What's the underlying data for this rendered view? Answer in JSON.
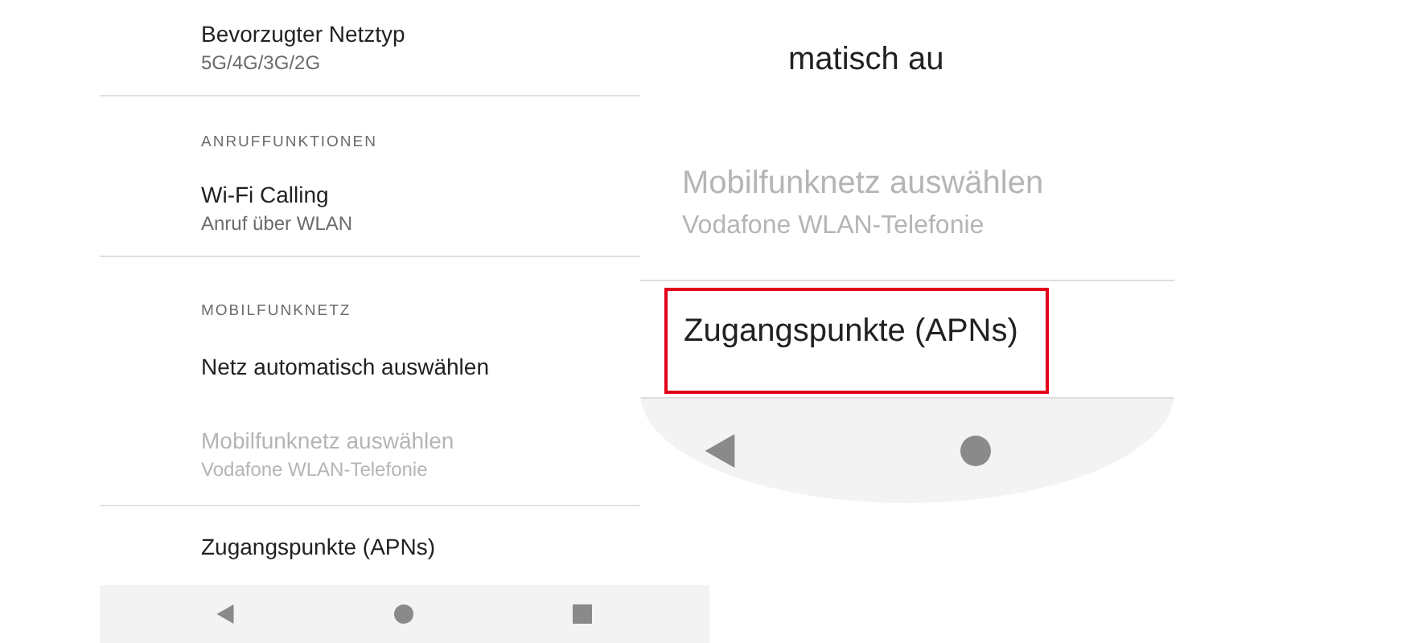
{
  "settings": {
    "items": [
      {
        "kind": "item",
        "title": "Bevorzugter Netztyp",
        "subtitle": "5G/4G/3G/2G",
        "disabled": false
      },
      {
        "kind": "header",
        "title": "ANRUFFUNKTIONEN"
      },
      {
        "kind": "item",
        "title": "Wi-Fi Calling",
        "subtitle": "Anruf über WLAN",
        "disabled": false
      },
      {
        "kind": "header",
        "title": "MOBILFUNKNETZ"
      },
      {
        "kind": "item",
        "title": "Netz automatisch auswählen",
        "disabled": false
      },
      {
        "kind": "item",
        "title": "Mobilfunknetz auswählen",
        "subtitle": "Vodafone WLAN-Telefonie",
        "disabled": true
      },
      {
        "kind": "item",
        "title": "Zugangspunkte (APNs)",
        "disabled": false
      }
    ]
  },
  "magnifier": {
    "partial_text": "matisch au",
    "items": [
      {
        "title": "Mobilfunknetz auswählen",
        "subtitle": "Vodafone WLAN-Telefonie",
        "disabled": true,
        "highlighted": false
      },
      {
        "title": "Zugangspunkte (APNs)",
        "disabled": false,
        "highlighted": true
      }
    ]
  }
}
